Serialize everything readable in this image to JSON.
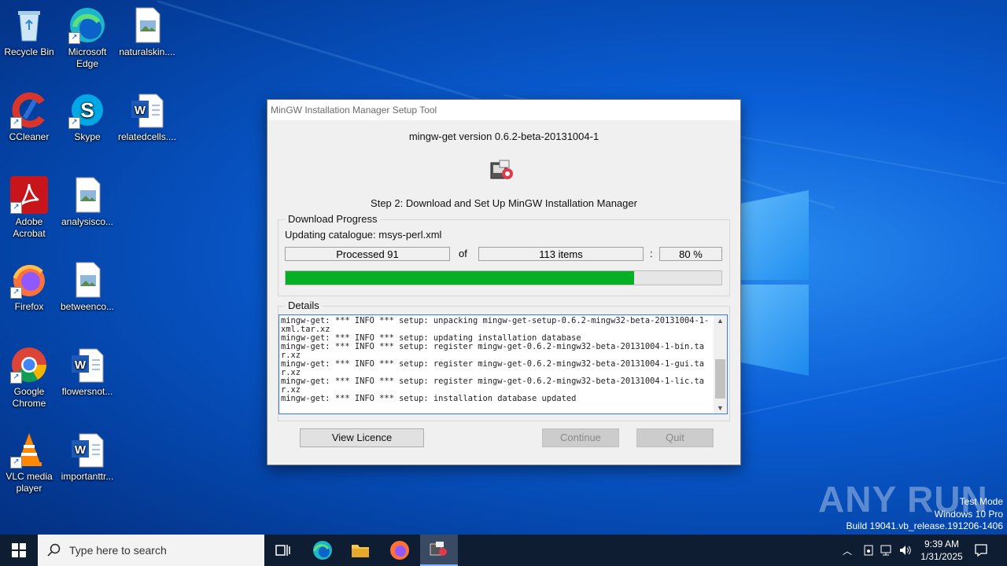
{
  "desktop": {
    "icons": [
      {
        "label": "Recycle Bin"
      },
      {
        "label": "Microsoft Edge"
      },
      {
        "label": "naturalskin...."
      },
      {
        "label": "CCleaner"
      },
      {
        "label": "Skype"
      },
      {
        "label": "relatedcells...."
      },
      {
        "label": "Adobe Acrobat"
      },
      {
        "label": "analysisco..."
      },
      {
        "label": "Firefox"
      },
      {
        "label": "betweenco..."
      },
      {
        "label": "Google Chrome"
      },
      {
        "label": "flowersnot..."
      },
      {
        "label": "VLC media player"
      },
      {
        "label": "importanttr..."
      }
    ]
  },
  "dialog": {
    "title": "MinGW Installation Manager Setup Tool",
    "version": "mingw-get version 0.6.2-beta-20131004-1",
    "step": "Step 2: Download and Set Up MinGW Installation Manager",
    "download_group": "Download Progress",
    "status": "Updating catalogue: msys-perl.xml",
    "processed": "Processed 91",
    "of": "of",
    "items": "113 items",
    "colon": ":",
    "percent": "80 %",
    "progress": 0.8,
    "details_group": "Details",
    "log": "mingw-get: *** INFO *** setup: unpacking mingw-get-setup-0.6.2-mingw32-beta-20131004-1-xml.tar.xz\nmingw-get: *** INFO *** setup: updating installation database\nmingw-get: *** INFO *** setup: register mingw-get-0.6.2-mingw32-beta-20131004-1-bin.tar.xz\nmingw-get: *** INFO *** setup: register mingw-get-0.6.2-mingw32-beta-20131004-1-gui.tar.xz\nmingw-get: *** INFO *** setup: register mingw-get-0.6.2-mingw32-beta-20131004-1-lic.tar.xz\nmingw-get: *** INFO *** setup: installation database updated\n",
    "buttons": {
      "licence": "View Licence",
      "continue": "Continue",
      "quit": "Quit"
    }
  },
  "watermark": {
    "brand": "ANY RUN",
    "line1": "Test Mode",
    "line2": "Windows 10 Pro",
    "line3": "Build 19041.vb_release.191206-1406"
  },
  "taskbar": {
    "search_placeholder": "Type here to search",
    "time": "9:39 AM",
    "date": "1/31/2025"
  },
  "colors": {
    "progress": "#06b025",
    "accent": "#0078d7"
  }
}
